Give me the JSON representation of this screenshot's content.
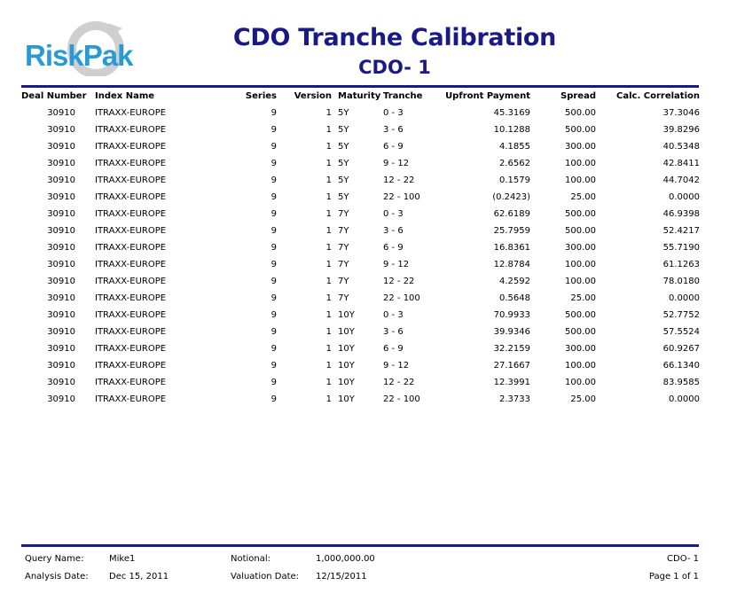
{
  "logo": {
    "text": "RiskPak"
  },
  "report": {
    "title": "CDO Tranche Calibration",
    "subtitle": "CDO- 1"
  },
  "columns": {
    "deal": "Deal Number",
    "index": "Index Name",
    "series": "Series",
    "version": "Version",
    "maturity": "Maturity",
    "tranche": "Tranche",
    "upfront": "Upfront Payment",
    "spread": "Spread",
    "corr": "Calc. Correlation"
  },
  "rows": [
    {
      "deal": "30910",
      "index": "ITRAXX-EUROPE",
      "series": "9",
      "version": "1",
      "maturity": "5Y",
      "tranche": "0 - 3",
      "upfront": "45.3169",
      "spread": "500.00",
      "corr": "37.3046"
    },
    {
      "deal": "30910",
      "index": "ITRAXX-EUROPE",
      "series": "9",
      "version": "1",
      "maturity": "5Y",
      "tranche": "3 - 6",
      "upfront": "10.1288",
      "spread": "500.00",
      "corr": "39.8296"
    },
    {
      "deal": "30910",
      "index": "ITRAXX-EUROPE",
      "series": "9",
      "version": "1",
      "maturity": "5Y",
      "tranche": "6 - 9",
      "upfront": "4.1855",
      "spread": "300.00",
      "corr": "40.5348"
    },
    {
      "deal": "30910",
      "index": "ITRAXX-EUROPE",
      "series": "9",
      "version": "1",
      "maturity": "5Y",
      "tranche": "9 - 12",
      "upfront": "2.6562",
      "spread": "100.00",
      "corr": "42.8411"
    },
    {
      "deal": "30910",
      "index": "ITRAXX-EUROPE",
      "series": "9",
      "version": "1",
      "maturity": "5Y",
      "tranche": "12 - 22",
      "upfront": "0.1579",
      "spread": "100.00",
      "corr": "44.7042"
    },
    {
      "deal": "30910",
      "index": "ITRAXX-EUROPE",
      "series": "9",
      "version": "1",
      "maturity": "5Y",
      "tranche": "22 - 100",
      "upfront": "(0.2423)",
      "spread": "25.00",
      "corr": "0.0000"
    },
    {
      "deal": "30910",
      "index": "ITRAXX-EUROPE",
      "series": "9",
      "version": "1",
      "maturity": "7Y",
      "tranche": "0 - 3",
      "upfront": "62.6189",
      "spread": "500.00",
      "corr": "46.9398"
    },
    {
      "deal": "30910",
      "index": "ITRAXX-EUROPE",
      "series": "9",
      "version": "1",
      "maturity": "7Y",
      "tranche": "3 - 6",
      "upfront": "25.7959",
      "spread": "500.00",
      "corr": "52.4217"
    },
    {
      "deal": "30910",
      "index": "ITRAXX-EUROPE",
      "series": "9",
      "version": "1",
      "maturity": "7Y",
      "tranche": "6 - 9",
      "upfront": "16.8361",
      "spread": "300.00",
      "corr": "55.7190"
    },
    {
      "deal": "30910",
      "index": "ITRAXX-EUROPE",
      "series": "9",
      "version": "1",
      "maturity": "7Y",
      "tranche": "9 - 12",
      "upfront": "12.8784",
      "spread": "100.00",
      "corr": "61.1263"
    },
    {
      "deal": "30910",
      "index": "ITRAXX-EUROPE",
      "series": "9",
      "version": "1",
      "maturity": "7Y",
      "tranche": "12 - 22",
      "upfront": "4.2592",
      "spread": "100.00",
      "corr": "78.0180"
    },
    {
      "deal": "30910",
      "index": "ITRAXX-EUROPE",
      "series": "9",
      "version": "1",
      "maturity": "7Y",
      "tranche": "22 - 100",
      "upfront": "0.5648",
      "spread": "25.00",
      "corr": "0.0000"
    },
    {
      "deal": "30910",
      "index": "ITRAXX-EUROPE",
      "series": "9",
      "version": "1",
      "maturity": "10Y",
      "tranche": "0 - 3",
      "upfront": "70.9933",
      "spread": "500.00",
      "corr": "52.7752"
    },
    {
      "deal": "30910",
      "index": "ITRAXX-EUROPE",
      "series": "9",
      "version": "1",
      "maturity": "10Y",
      "tranche": "3 - 6",
      "upfront": "39.9346",
      "spread": "500.00",
      "corr": "57.5524"
    },
    {
      "deal": "30910",
      "index": "ITRAXX-EUROPE",
      "series": "9",
      "version": "1",
      "maturity": "10Y",
      "tranche": "6 - 9",
      "upfront": "32.2159",
      "spread": "300.00",
      "corr": "60.9267"
    },
    {
      "deal": "30910",
      "index": "ITRAXX-EUROPE",
      "series": "9",
      "version": "1",
      "maturity": "10Y",
      "tranche": "9 - 12",
      "upfront": "27.1667",
      "spread": "100.00",
      "corr": "66.1340"
    },
    {
      "deal": "30910",
      "index": "ITRAXX-EUROPE",
      "series": "9",
      "version": "1",
      "maturity": "10Y",
      "tranche": "12 - 22",
      "upfront": "12.3991",
      "spread": "100.00",
      "corr": "83.9585"
    },
    {
      "deal": "30910",
      "index": "ITRAXX-EUROPE",
      "series": "9",
      "version": "1",
      "maturity": "10Y",
      "tranche": "22 - 100",
      "upfront": "2.3733",
      "spread": "25.00",
      "corr": "0.0000"
    }
  ],
  "footer": {
    "query_label": "Query Name:",
    "query_value": "Mike1",
    "analysis_label": "Analysis Date:",
    "analysis_value": "Dec 15, 2011",
    "notional_label": "Notional:",
    "notional_value": "1,000,000.00",
    "valuation_label": "Valuation Date:",
    "valuation_value": "12/15/2011",
    "report_name": "CDO- 1",
    "page": "Page 1 of 1"
  },
  "colors": {
    "accent": "#1a1a86",
    "logo_blue": "#2a9ad6",
    "logo_swoosh": "#c8c8c8"
  }
}
